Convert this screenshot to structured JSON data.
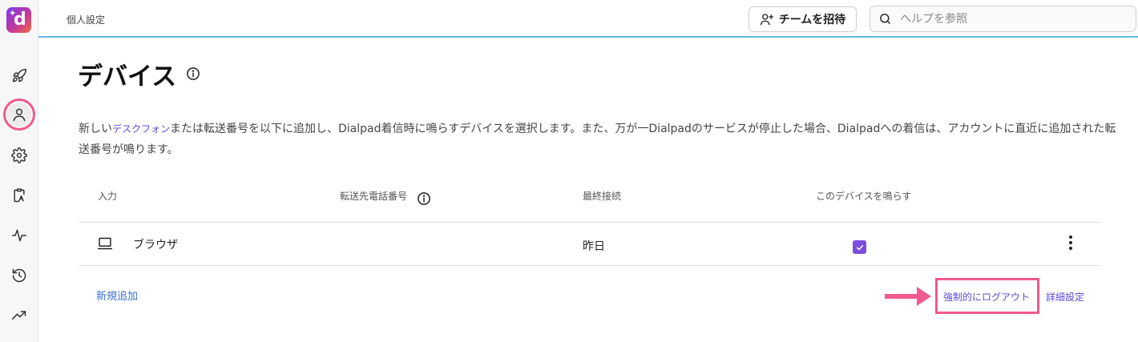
{
  "app": {
    "logo_letter": "d"
  },
  "header": {
    "breadcrumb": "個人設定",
    "invite_label": "チームを招待",
    "search_placeholder": "ヘルプを参照"
  },
  "sidebar": {
    "items": [
      {
        "name": "rocket-icon"
      },
      {
        "name": "person-icon",
        "active": true
      },
      {
        "name": "gear-icon"
      },
      {
        "name": "clipboard-icon"
      },
      {
        "name": "activity-icon"
      },
      {
        "name": "history-icon"
      },
      {
        "name": "trend-icon"
      }
    ]
  },
  "page": {
    "title": "デバイス",
    "desc_prefix": "新しい",
    "desc_link": "デスクフォン",
    "desc_suffix": "または転送番号を以下に追加し、Dialpad着信時に鳴らすデバイスを選択します。また、万が一Dialpadのサービスが停止した場合、Dialpadへの着信は、アカウントに直近に追加された転送番号が鳴ります。"
  },
  "table": {
    "headers": [
      "入力",
      "転送先電話番号",
      "最終接続",
      "このデバイスを鳴らす"
    ],
    "rows": [
      {
        "device": "ブラウザ",
        "forward_number": "",
        "last_connected": "昨日",
        "ring": true
      }
    ]
  },
  "actions": {
    "add_new": "新規追加",
    "force_logout": "強制的にログアウト",
    "details": "詳細設定"
  },
  "colors": {
    "accent": "#5a4bd6",
    "link_blue": "#3d6fd9",
    "highlight": "#f05a8c",
    "checkbox": "#7c4ddb",
    "topbar_line": "#66b6e8"
  }
}
